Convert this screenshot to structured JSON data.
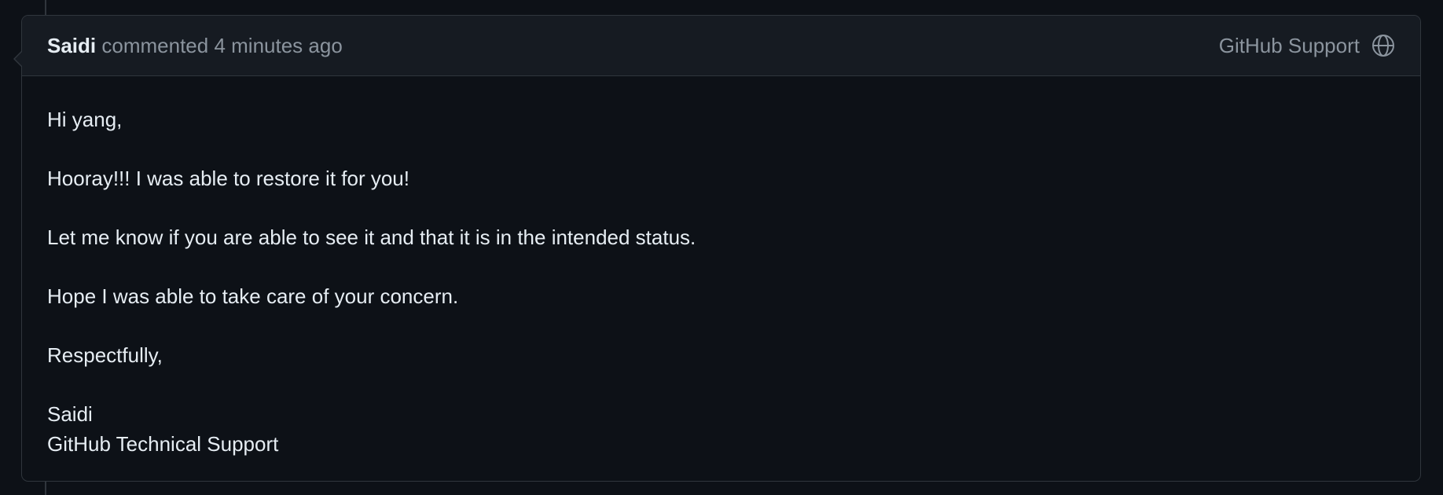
{
  "comment": {
    "author": "Saidi",
    "action": "commented",
    "time": "4 minutes ago",
    "badge_label": "GitHub Support",
    "badge_icon": "globe-icon",
    "body": {
      "greeting": "Hi yang,",
      "line1": "Hooray!!! I was able to restore it for you!",
      "line2": "Let me know if you are able to see it and that it is in the intended status.",
      "line3": "Hope I was able to take care of your concern.",
      "closing": "Respectfully,",
      "signature_name": "Saidi",
      "signature_title": "GitHub Technical Support"
    }
  },
  "colors": {
    "background": "#0d1117",
    "header_background": "#161b22",
    "border": "#30363d",
    "text_primary": "#e6edf3",
    "text_muted": "#8b949e"
  }
}
